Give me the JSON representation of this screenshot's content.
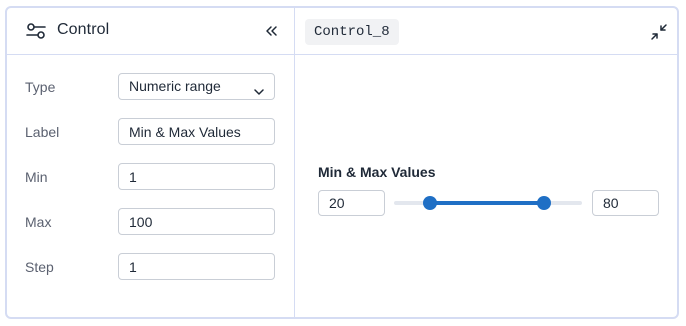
{
  "left_panel": {
    "title": "Control",
    "icons": {
      "control": "sliders-icon",
      "collapse": "double-chevron-left-icon"
    },
    "fields": {
      "type": {
        "label": "Type",
        "value": "Numeric range"
      },
      "label": {
        "label": "Label",
        "value": "Min & Max Values"
      },
      "min": {
        "label": "Min",
        "value": "1"
      },
      "max": {
        "label": "Max",
        "value": "100"
      },
      "step": {
        "label": "Step",
        "value": "1"
      }
    }
  },
  "right_panel": {
    "control_name": "Control_8",
    "icons": {
      "minimize": "minimize-arrows-icon"
    },
    "slider": {
      "title": "Min & Max Values",
      "min_value": "20",
      "max_value": "80",
      "range_min": 1,
      "range_max": 100,
      "low": 20,
      "high": 80
    }
  },
  "colors": {
    "accent": "#1f6fc5",
    "border": "#d5dcf3",
    "input_border": "#c9ced6",
    "label_text": "#5b6170",
    "tag_background": "#f1f2f4"
  }
}
